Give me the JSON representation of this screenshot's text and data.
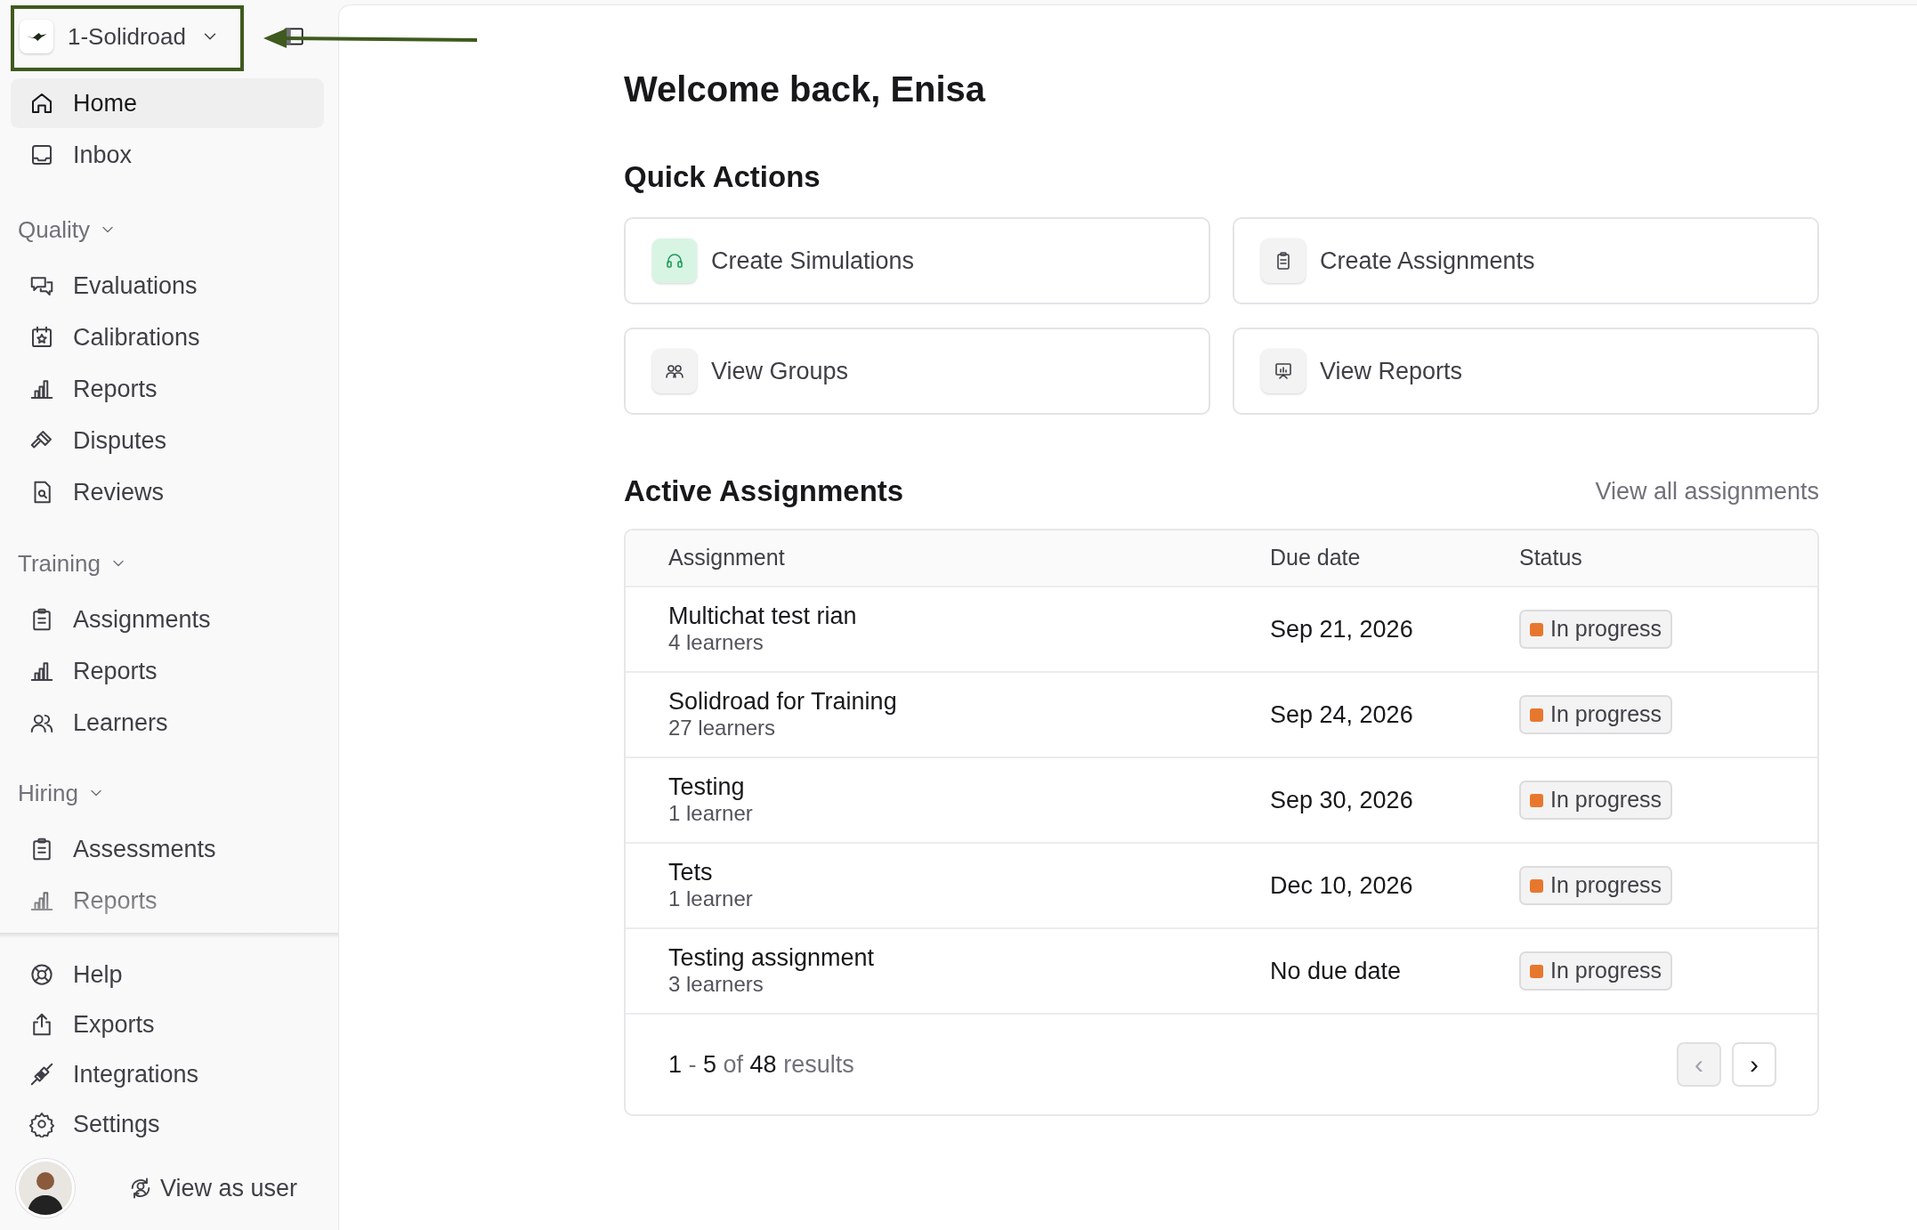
{
  "workspace": {
    "name": "1-Solidroad"
  },
  "nav_top": [
    {
      "label": "Home",
      "selected": true
    },
    {
      "label": "Inbox",
      "selected": false
    }
  ],
  "sections": [
    {
      "title": "Quality",
      "expanded": true,
      "items": [
        {
          "label": "Evaluations",
          "selected": false
        },
        {
          "label": "Calibrations",
          "selected": false
        },
        {
          "label": "Reports",
          "selected": false
        },
        {
          "label": "Disputes",
          "selected": false
        },
        {
          "label": "Reviews",
          "selected": false
        }
      ]
    },
    {
      "title": "Training",
      "expanded": true,
      "items": [
        {
          "label": "Assignments",
          "selected": false
        },
        {
          "label": "Reports",
          "selected": false
        },
        {
          "label": "Learners",
          "selected": false
        }
      ]
    },
    {
      "title": "Hiring",
      "expanded": true,
      "items": [
        {
          "label": "Assessments",
          "selected": false
        },
        {
          "label": "Reports",
          "selected": false
        }
      ]
    }
  ],
  "nav_bottom": [
    {
      "label": "Help"
    },
    {
      "label": "Exports"
    },
    {
      "label": "Integrations"
    },
    {
      "label": "Settings"
    }
  ],
  "user": {
    "action": "View as user"
  },
  "greeting": "Welcome back, Enisa",
  "quick_actions": {
    "title": "Quick Actions",
    "items": [
      {
        "label": "Create Simulations",
        "color": "#d8f5e4"
      },
      {
        "label": "Create Assignments",
        "color": "#f3f3f3"
      },
      {
        "label": "View Groups",
        "color": "#f3f3f3"
      },
      {
        "label": "View Reports",
        "color": "#f3f3f3"
      }
    ]
  },
  "assignments": {
    "title": "Active Assignments",
    "view_all": "View all assignments",
    "columns": [
      "Assignment",
      "Due date",
      "Status"
    ],
    "rows": [
      {
        "name": "Multichat test rian",
        "learners": "4 learners",
        "due": "Sep 21, 2026",
        "status": "In progress",
        "color": "#e8772e"
      },
      {
        "name": "Solidroad for Training",
        "learners": "27 learners",
        "due": "Sep 24, 2026",
        "status": "In progress",
        "color": "#e8772e"
      },
      {
        "name": "Testing",
        "learners": "1 learner",
        "due": "Sep 30, 2026",
        "status": "In progress",
        "color": "#e8772e"
      },
      {
        "name": "Tets",
        "learners": "1 learner",
        "due": "Dec 10, 2026",
        "status": "In progress",
        "color": "#e8772e"
      },
      {
        "name": "Testing assignment",
        "learners": "3 learners",
        "due": "No due date",
        "status": "In progress",
        "color": "#e8772e"
      }
    ],
    "summary": "**1** - **5** of **48** results",
    "prev": {
      "label": "‹",
      "disabled": true
    },
    "next": {
      "label": "›",
      "disabled": false
    }
  }
}
